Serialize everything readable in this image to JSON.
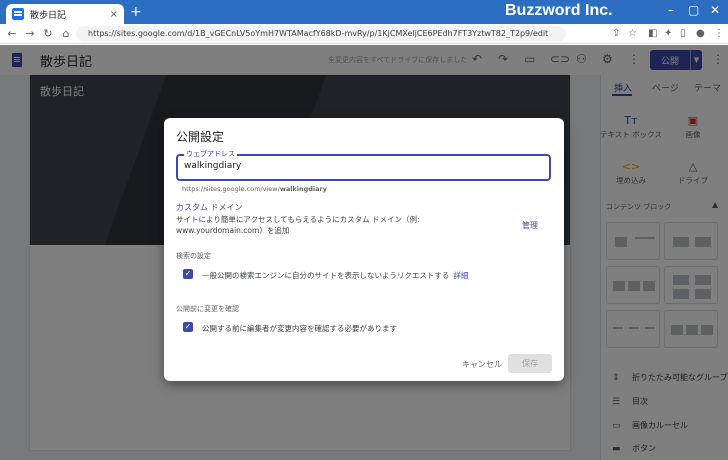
{
  "browser": {
    "tab_title": "散歩日記",
    "tab_close": "×",
    "new_tab": "+",
    "brand": "Buzzword Inc.",
    "url": "https://sites.google.com/d/1B_vGECnLV5oYmH7WTAMacfY68kD-mvRy/p/1KjCMXeljCE6PEdh7FT3YztwT82_T2p9/edit",
    "icons": [
      "back-icon",
      "forward-icon",
      "reload-icon",
      "home-icon",
      "share-icon",
      "star-icon",
      "extension-icon",
      "puzzle-icon",
      "sidepanel-icon",
      "profile-icon",
      "menu-icon"
    ]
  },
  "app": {
    "site_name": "散歩日記",
    "save_status": "全変更内容をすべてドライブに保存しました",
    "publish_label": "公開",
    "accent": "#3c4aa8"
  },
  "canvas": {
    "hero_title": "散歩日記"
  },
  "right_panel": {
    "tabs": [
      "挿入",
      "ページ",
      "テーマ"
    ],
    "tiles": [
      {
        "icon": "Tт",
        "label": "テキスト ボックス"
      },
      {
        "icon": "▣",
        "label": "画像"
      },
      {
        "icon": "<>",
        "label": "埋め込み"
      },
      {
        "icon": "△",
        "label": "ドライブ"
      }
    ],
    "section_header": "コンテンツ ブロック",
    "items": [
      {
        "icon": "⇕",
        "label": "折りたたみ可能なグループ"
      },
      {
        "icon": "☰",
        "label": "目次"
      },
      {
        "icon": "▭",
        "label": "画像カルーセル"
      },
      {
        "icon": "▬",
        "label": "ボタン"
      }
    ]
  },
  "dialog": {
    "title": "公開設定",
    "web_address_label": "ウェブアドレス",
    "web_address_value": "walkingdiary",
    "url_prefix": "https://sites.google.com/view/",
    "url_suffix": "walkingdiary",
    "custom_domain_label": "カスタム ドメイン",
    "custom_domain_desc": "サイトにより簡単にアクセスしてもらえるようにカスタム ドメイン（例: www.yourdomain.com）を追加",
    "manage_label": "管理",
    "search_section": "検索の設定",
    "search_checkbox": "一般公開の検索エンジンに自分のサイトを表示しないようリクエストする",
    "search_detail_link": "詳細",
    "review_section": "公開前に変更を確認",
    "review_checkbox": "公開する前に編集者が変更内容を確認する必要があります",
    "cancel_label": "キャンセル",
    "save_label": "保存"
  }
}
